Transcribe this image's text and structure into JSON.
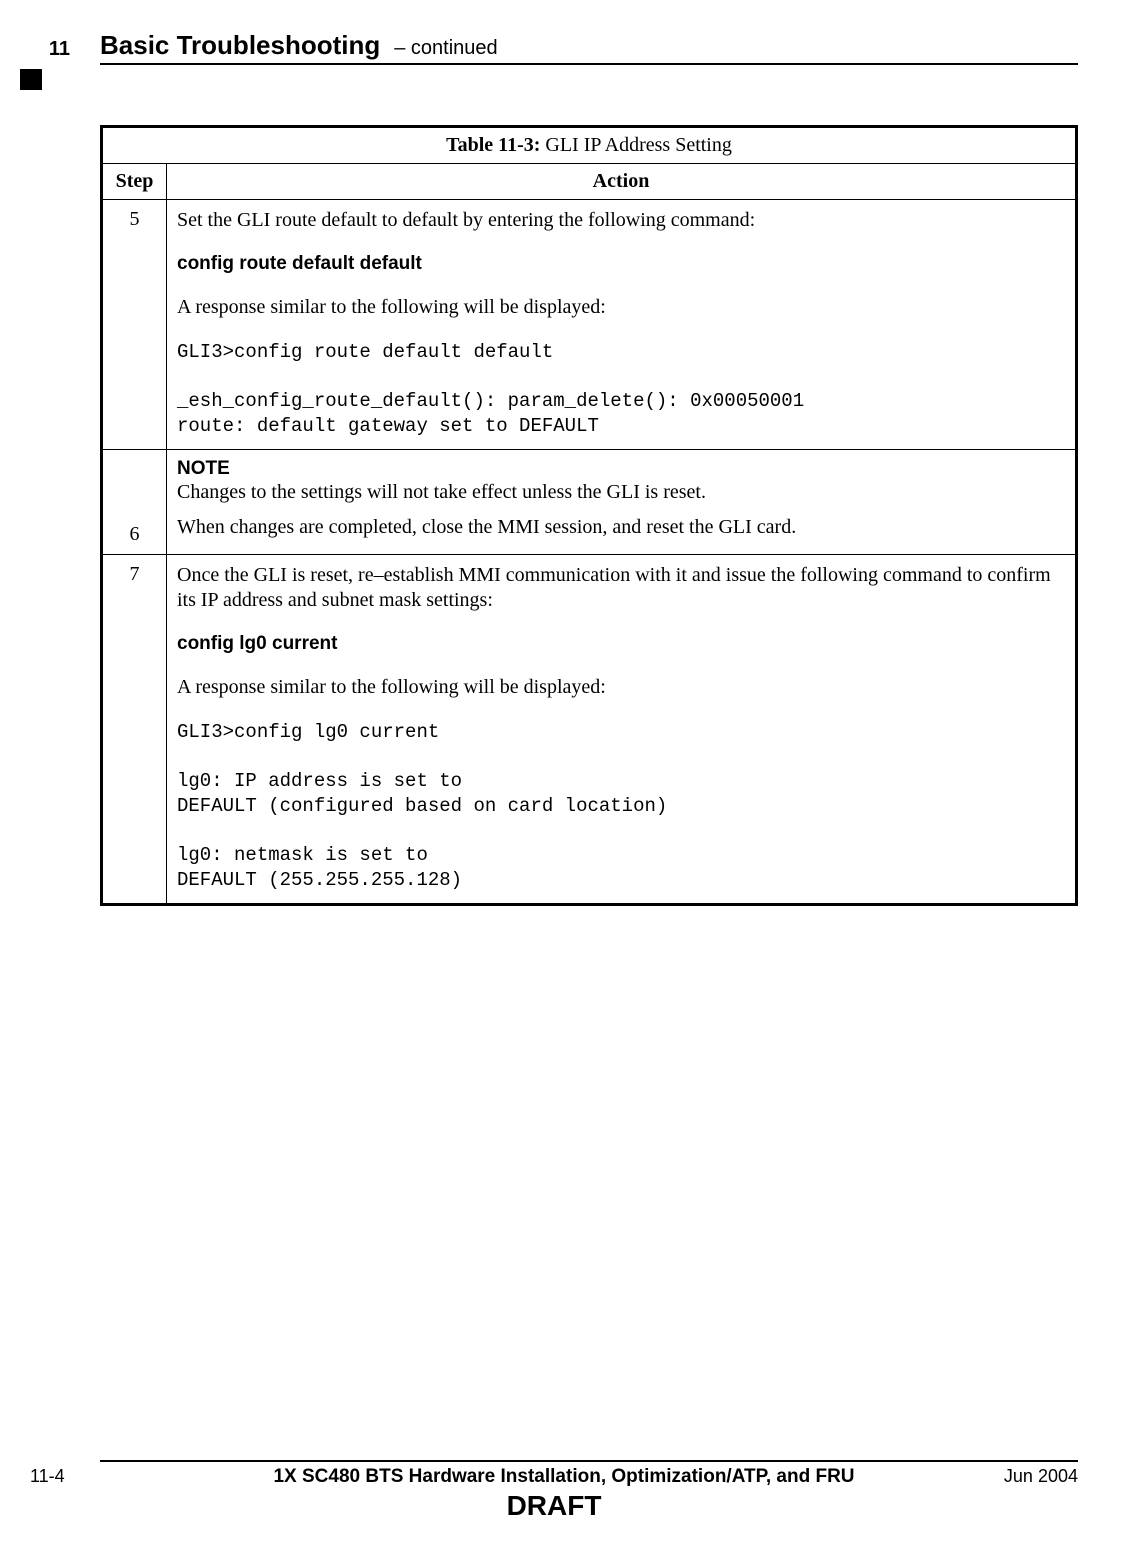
{
  "header": {
    "chapter_number": "11",
    "title": "Basic Troubleshooting",
    "continued": "– continued"
  },
  "table": {
    "caption_prefix": "Table 11-3:",
    "caption_text": " GLI IP Address Setting",
    "col_step": "Step",
    "col_action": "Action",
    "rows": {
      "r5": {
        "step": "5",
        "intro": "Set the GLI route default to default by entering the following command:",
        "cmd": "config route default default",
        "resp_intro": "A response similar to the following will be displayed:",
        "output": "GLI3>config route default default\n\n_esh_config_route_default(): param_delete(): 0x00050001\nroute: default gateway set to DEFAULT"
      },
      "r6": {
        "step": "6",
        "note_head": "NOTE",
        "note_body": "Changes to the settings will not take effect unless the GLI is reset.",
        "action": "When changes are completed, close the MMI session, and reset the GLI card."
      },
      "r7": {
        "step": "7",
        "intro": "Once the GLI is reset, re–establish MMI communication with it and issue the following command to confirm its IP address and subnet mask settings:",
        "cmd": "config lg0 current",
        "resp_intro": "A response similar to the following will be displayed:",
        "output": "GLI3>config lg0 current\n\nlg0: IP address is set to\nDEFAULT (configured based on card location)\n\nlg0: netmask is set to\nDEFAULT (255.255.255.128)"
      }
    }
  },
  "footer": {
    "page": "11-4",
    "doc_title": "1X SC480 BTS Hardware Installation, Optimization/ATP, and FRU",
    "date": "Jun 2004",
    "draft": "DRAFT"
  }
}
